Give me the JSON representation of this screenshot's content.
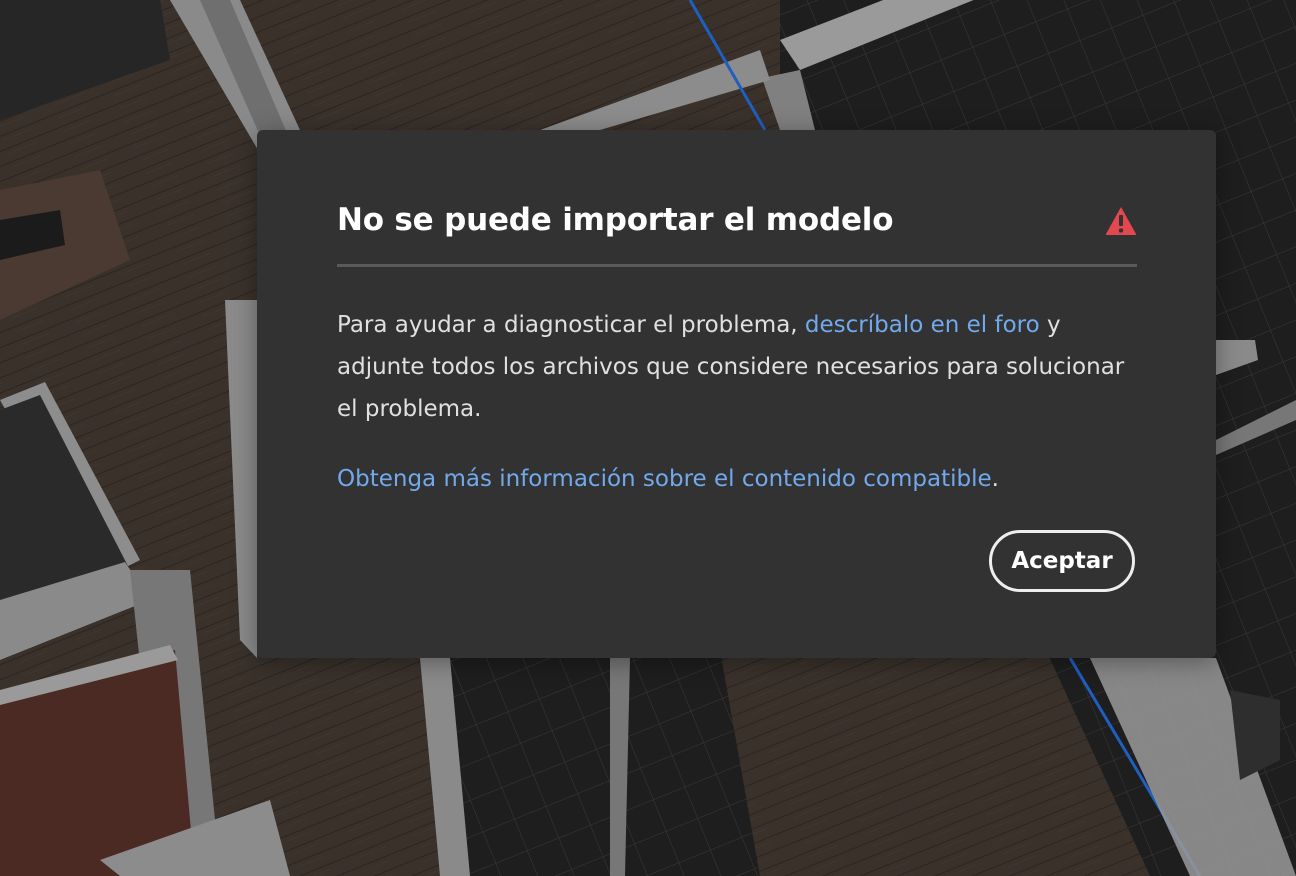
{
  "dialog": {
    "title": "No se puede importar el modelo",
    "icon": "alert-triangle-icon",
    "icon_color": "#e34850",
    "body_prefix": "Para ayudar a diagnosticar el problema, ",
    "body_link": "descríbalo en el foro",
    "body_suffix": " y adjunte todos los archivos que considere necesarios para solucionar el problema.",
    "learn_more_link": "Obtenga más información sobre el contenido compatible",
    "learn_more_suffix": ".",
    "link_color": "#72a9ec",
    "accept_label": "Aceptar"
  },
  "background": {
    "description_icon": "3d-scene-viewport"
  }
}
